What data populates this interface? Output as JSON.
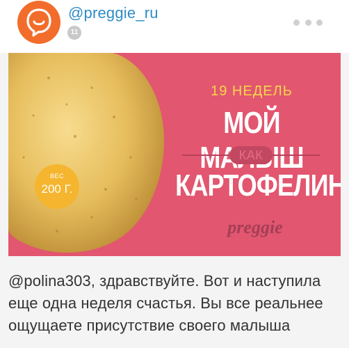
{
  "post": {
    "username": "@preggie_ru",
    "badge_count": "11",
    "more_icon": "more-dots-icon",
    "avatar_icon": "chat-bubble-logo",
    "colors": {
      "avatar": "#f26d2b",
      "username": "#2f8cc6",
      "image_background": "#e2566f",
      "weeks_text": "#f8d64a",
      "weight_badge": "#f5b52e"
    }
  },
  "image": {
    "weeks_label": "19 НЕДЕЛЬ",
    "line1": "МОЙ МАЛЫШ",
    "connector": "КАК",
    "line2": "КАРТОФЕЛИНА",
    "brand": "preggie",
    "weight_label": "ВЕС",
    "weight_value": "200 Г."
  },
  "caption": {
    "text": "@polina303, здравствуйте. Вот и наступила еще одна неделя счастья. Вы все реальнее ощущаете присутствие своего малыша"
  }
}
